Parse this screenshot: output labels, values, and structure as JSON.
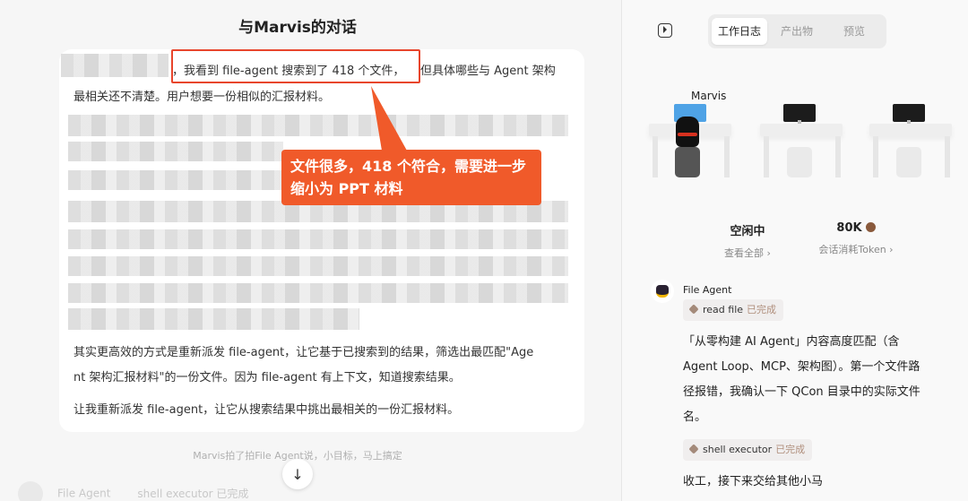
{
  "chat": {
    "title": "与Marvis的对话",
    "highlight_text": "，我看到 file-agent 搜索到了 418 个文件，",
    "line1_rest": "但具体哪些与 Agent 架构",
    "line2": "最相关还不清楚。用户想要一份相似的汇报材料。",
    "callout": "文件很多，418 个符合，需要进一步缩小为 PPT 材料",
    "para2_l1": "其实更高效的方式是重新派发 file-agent，让它基于已搜索到的结果，筛选出最匹配\"Age",
    "para2_l2": "nt 架构汇报材料\"的一份文件。因为 file-agent 有上下文，知道搜索结果。",
    "para3": "让我重新派发 file-agent，让它从搜索结果中挑出最相关的一份汇报材料。",
    "footer_note": "Marvis拍了拍File Agent说，小目标，马上搞定",
    "scroll_down_icon": "↓",
    "bottom_agent_name": "File Agent",
    "bottom_tool": "shell executor 已完成"
  },
  "panel": {
    "tabs": [
      {
        "label": "工作日志",
        "active": true
      },
      {
        "label": "产出物",
        "active": false
      },
      {
        "label": "预览",
        "active": false
      }
    ],
    "office": {
      "agent_label": "Marvis"
    },
    "stats": {
      "status": "空闲中",
      "status_link": "查看全部 ›",
      "tokens": "80K",
      "tokens_link": "会话消耗Token ›"
    },
    "log": {
      "agent_name": "File Agent",
      "tool1_name": "read file",
      "tool1_status": "已完成",
      "text1_l1": "「从零构建 AI Agent」内容高度匹配（含",
      "text1_l2": "Agent Loop、MCP、架构图）。第一个文件路",
      "text1_l3": "径报错，我确认一下 QCon 目录中的实际文件",
      "text1_l4": "名。",
      "tool2_name": "shell executor",
      "tool2_status": "已完成",
      "text2": "收工，接下来交给其他小马"
    }
  },
  "colors": {
    "accent_orange": "#f05a2a",
    "highlight_border": "#e8452c"
  }
}
